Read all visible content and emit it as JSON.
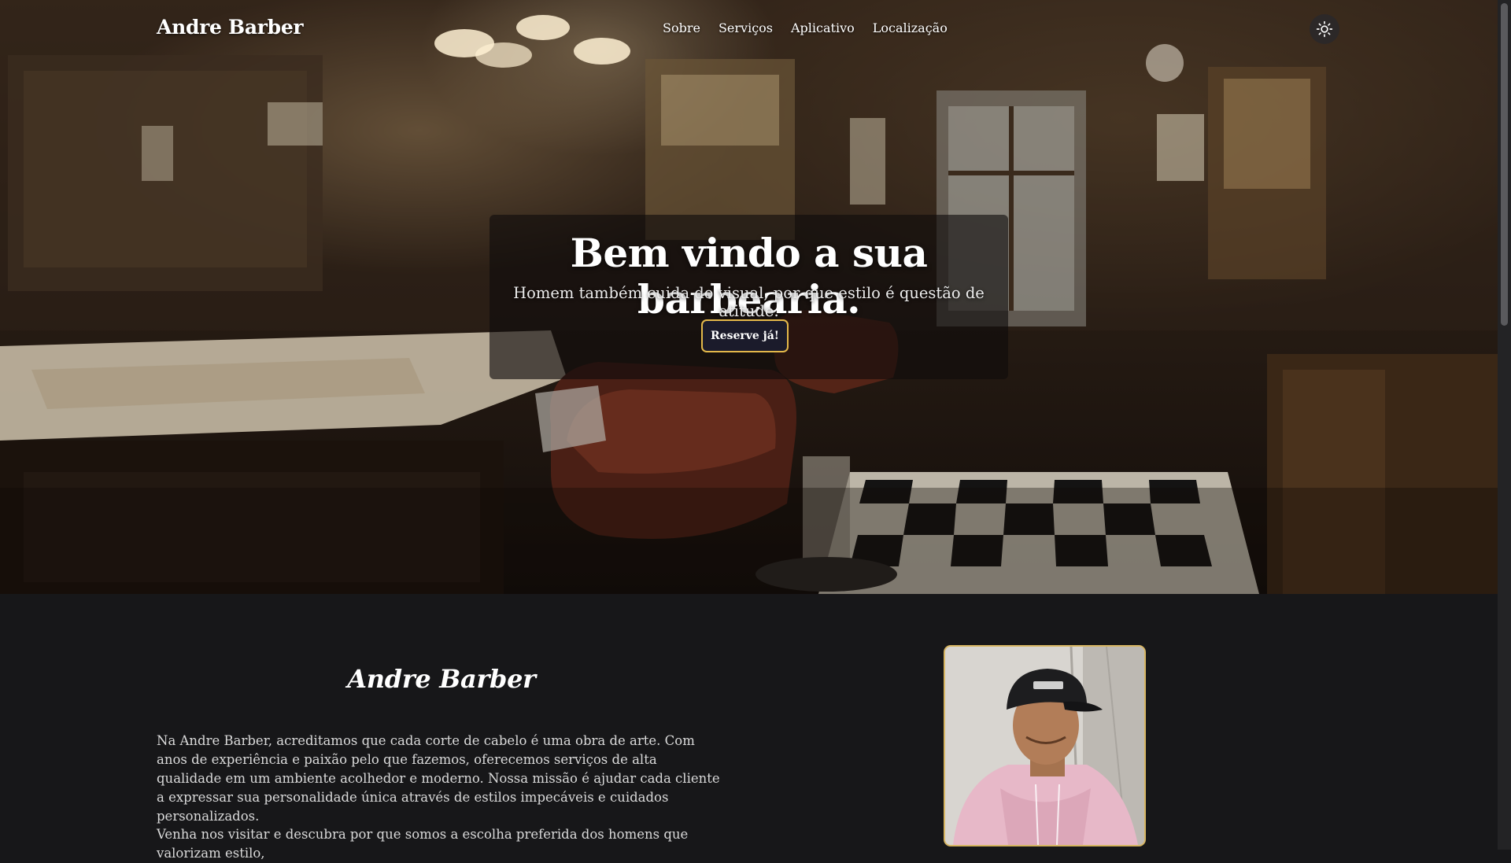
{
  "nav": {
    "brand": "Andre Barber",
    "links": [
      "Sobre",
      "Serviços",
      "Aplicativo",
      "Localização"
    ],
    "theme_toggle_icon": "sun-icon"
  },
  "hero": {
    "title": "Bem vindo a sua barbearia.",
    "subtitle": "Homem também cuida do visual, por que estilo é questão de atitude.",
    "cta_label": "Reserve já!",
    "background_image": "barbershop-interior"
  },
  "about": {
    "heading": "Andre Barber",
    "paragraph_1": "Na Andre Barber, acreditamos que cada corte de cabelo é uma obra de arte. Com anos de experiência e paixão pelo que fazemos, oferecemos serviços de alta qualidade em um ambiente acolhedor e moderno. Nossa missão é ajudar cada cliente a expressar sua personalidade única através de estilos impecáveis e cuidados personalizados.",
    "paragraph_2": "Venha nos visitar e descubra por que somos a escolha preferida dos homens que valorizam estilo,",
    "portrait_image": "barber-portrait"
  },
  "colors": {
    "page_background": "#171719",
    "accent_border": "#e3b84a",
    "button_background": "#1b1b2b"
  }
}
